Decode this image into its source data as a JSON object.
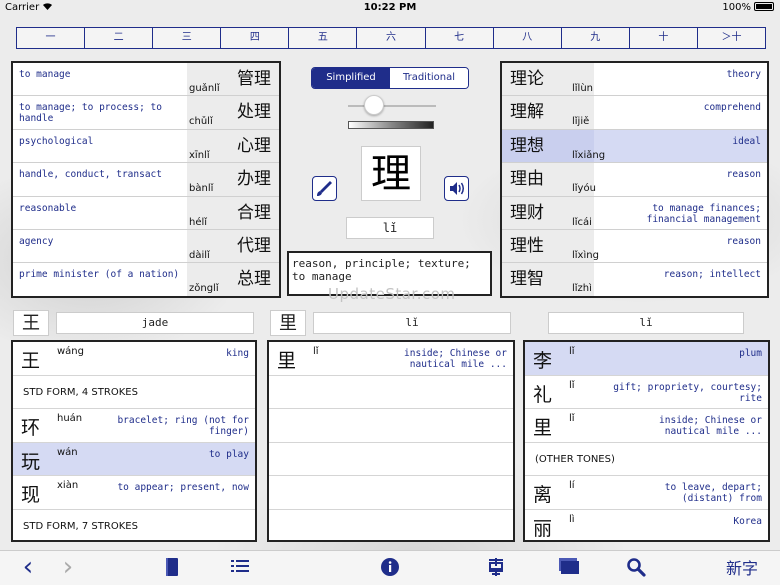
{
  "status": {
    "carrier": "Carrier",
    "time": "10:22 PM",
    "battery": "100%"
  },
  "stroke_tabs": [
    "一",
    "二",
    "三",
    "四",
    "五",
    "六",
    "七",
    "八",
    "九",
    "十",
    "＞十"
  ],
  "left_words": [
    {
      "def": "to manage",
      "hanzi": "管理",
      "pinyin": "guǎnlǐ"
    },
    {
      "def": "to manage; to process; to handle",
      "hanzi": "处理",
      "pinyin": "chǔlǐ"
    },
    {
      "def": "psychological",
      "hanzi": "心理",
      "pinyin": "xīnlǐ"
    },
    {
      "def": "handle, conduct, transact",
      "hanzi": "办理",
      "pinyin": "bànlǐ"
    },
    {
      "def": "reasonable",
      "hanzi": "合理",
      "pinyin": "hélǐ"
    },
    {
      "def": "agency",
      "hanzi": "代理",
      "pinyin": "dàilǐ"
    },
    {
      "def": "prime minister (of a nation)",
      "hanzi": "总理",
      "pinyin": "zǒnglǐ"
    }
  ],
  "right_words": [
    {
      "def": "theory",
      "hanzi": "理论",
      "pinyin": "lǐlùn",
      "selected": false
    },
    {
      "def": "comprehend",
      "hanzi": "理解",
      "pinyin": "lǐjiě",
      "selected": false
    },
    {
      "def": "ideal",
      "hanzi": "理想",
      "pinyin": "lǐxiǎng",
      "selected": true
    },
    {
      "def": "reason",
      "hanzi": "理由",
      "pinyin": "lǐyóu",
      "selected": false
    },
    {
      "def": "to manage finances; financial management",
      "hanzi": "理财",
      "pinyin": "lǐcái",
      "selected": false
    },
    {
      "def": "reason",
      "hanzi": "理性",
      "pinyin": "lǐxìng",
      "selected": false
    },
    {
      "def": "reason; intellect",
      "hanzi": "理智",
      "pinyin": "lǐzhì",
      "selected": false
    }
  ],
  "script_toggle": {
    "simplified": "Simplified",
    "traditional": "Traditional",
    "selected": "Simplified"
  },
  "main_char": {
    "hanzi": "理",
    "pinyin": "lǐ",
    "meaning": "reason, principle; texture; to manage"
  },
  "watermark": "UpdateStar.com",
  "components": [
    {
      "hanzi": "王",
      "meaning": "jade"
    },
    {
      "hanzi": "里",
      "meaning": "lǐ"
    },
    {
      "hanzi": "",
      "meaning": "lǐ"
    }
  ],
  "list1": [
    {
      "type": "item",
      "hanzi": "王",
      "pinyin": "wáng",
      "def": "king"
    },
    {
      "type": "header",
      "text": "STD FORM, 4 STROKES"
    },
    {
      "type": "item",
      "hanzi": "环",
      "pinyin": "huán",
      "def": "bracelet; ring (not for finger)"
    },
    {
      "type": "item",
      "hanzi": "玩",
      "pinyin": "wán",
      "def": "to play",
      "selected": true
    },
    {
      "type": "item",
      "hanzi": "现",
      "pinyin": "xiàn",
      "def": "to appear; present, now"
    },
    {
      "type": "header",
      "text": "STD FORM, 7 STROKES"
    }
  ],
  "list2": [
    {
      "type": "item",
      "hanzi": "里",
      "pinyin": "lǐ",
      "def": "inside; Chinese or nautical mile ..."
    }
  ],
  "list3": [
    {
      "type": "item",
      "hanzi": "李",
      "pinyin": "lǐ",
      "def": "plum",
      "selected": true
    },
    {
      "type": "item",
      "hanzi": "礼",
      "pinyin": "lǐ",
      "def": "gift; propriety, courtesy; rite"
    },
    {
      "type": "item",
      "hanzi": "里",
      "pinyin": "lǐ",
      "def": "inside; Chinese or nautical mile ..."
    },
    {
      "type": "header",
      "text": "(OTHER TONES)"
    },
    {
      "type": "item",
      "hanzi": "离",
      "pinyin": "lí",
      "def": "to leave, depart; (distant) from"
    },
    {
      "type": "item",
      "hanzi": "丽",
      "pinyin": "lì",
      "def": "Korea"
    }
  ],
  "toolbar": {
    "new_char": "新字",
    "back": "‹",
    "forward": "›"
  },
  "colors": {
    "accent": "#1f2d8a",
    "selected_row": "#d5daf3"
  }
}
